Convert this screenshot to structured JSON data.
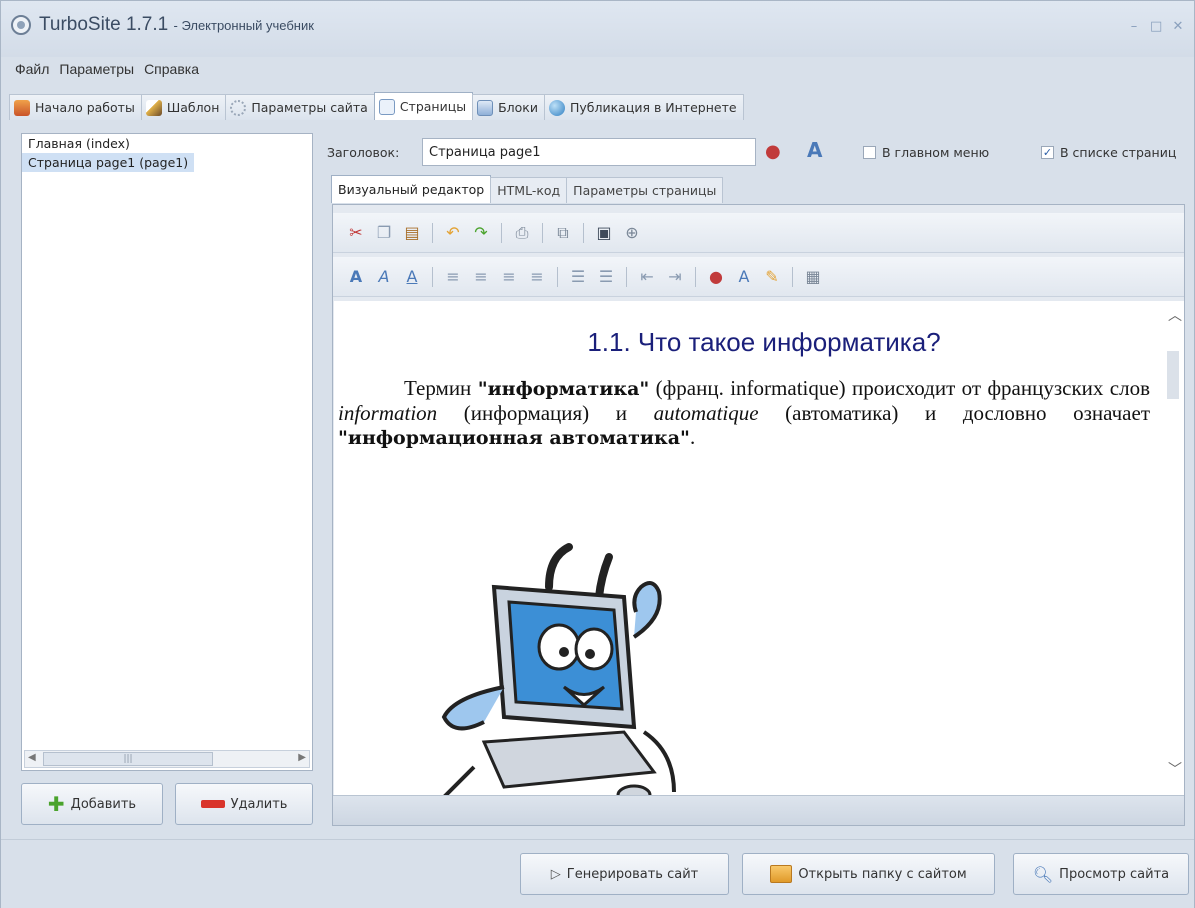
{
  "window": {
    "app_title": "TurboSite 1.7.1",
    "app_subtitle": "- Электронный учебник"
  },
  "menu": [
    "Файл",
    "Параметры",
    "Справка"
  ],
  "tabs": [
    {
      "label": "Начало работы",
      "icon": "home-icon"
    },
    {
      "label": "Шаблон",
      "icon": "brush-icon"
    },
    {
      "label": "Параметры сайта",
      "icon": "settings-icon"
    },
    {
      "label": "Страницы",
      "icon": "pages-icon",
      "active": true
    },
    {
      "label": "Блоки",
      "icon": "blocks-icon"
    },
    {
      "label": "Публикация в Интернете",
      "icon": "globe-icon"
    }
  ],
  "pages_list": [
    {
      "label": "Главная (index)",
      "selected": false
    },
    {
      "label": "Страница page1 (page1)",
      "selected": true
    }
  ],
  "left_buttons": {
    "add": "Добавить",
    "delete": "Удалить"
  },
  "header": {
    "label": "Заголовок:",
    "value": "Страница page1",
    "in_main_menu": {
      "label": "В главном меню",
      "checked": false
    },
    "in_page_list": {
      "label": "В списке страниц",
      "checked": true
    }
  },
  "editor_tabs": [
    {
      "label": "Визуальный редактор",
      "active": true
    },
    {
      "label": "HTML-код"
    },
    {
      "label": "Параметры страницы"
    }
  ],
  "document": {
    "heading": "1.1. Что такое информатика?",
    "p_term": "Термин ",
    "p_term_bold": "\"информатика\"",
    "p_after_term": " (франц. informatique) происходит от французских слов ",
    "p_information": "information",
    "p_information_tr": " (информация) и ",
    "p_automatique": "automatique",
    "p_automatique_tr": " (автоматика) и дословно означает ",
    "p_meaning_bold": "\"информационная автоматика\"",
    "p_end": "."
  },
  "bottom_buttons": {
    "generate": "Генерировать сайт",
    "open_folder": "Открыть папку с сайтом",
    "preview": "Просмотр сайта"
  }
}
